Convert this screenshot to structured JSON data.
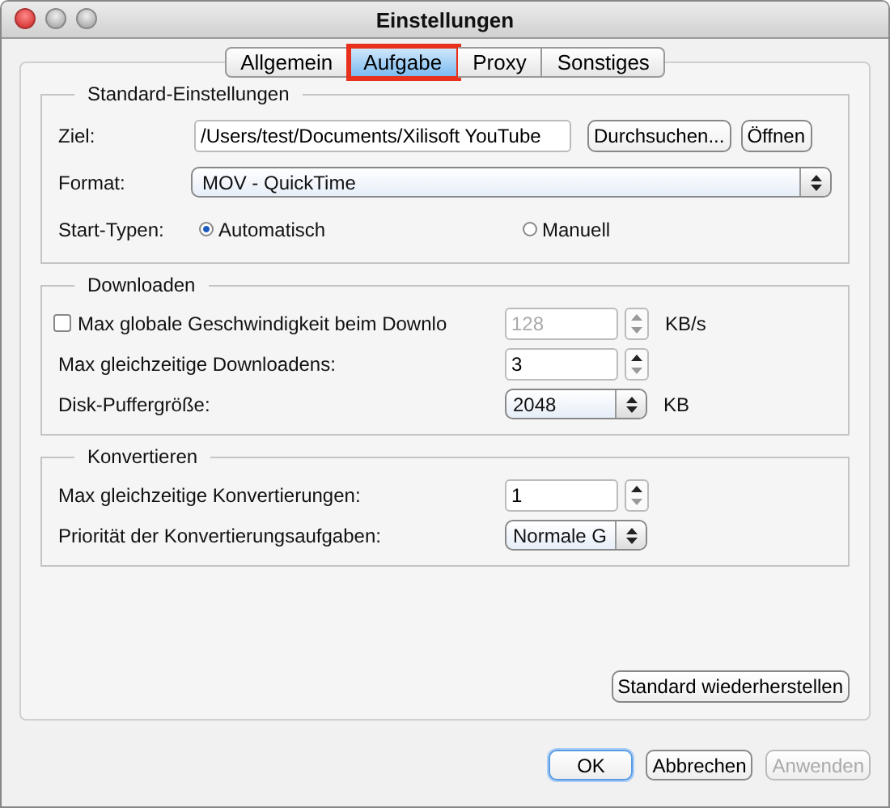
{
  "window": {
    "title": "Einstellungen"
  },
  "tabs": [
    {
      "label": "Allgemein",
      "selected": false,
      "highlighted": false
    },
    {
      "label": "Aufgabe",
      "selected": true,
      "highlighted": true
    },
    {
      "label": "Proxy",
      "selected": false,
      "highlighted": false
    },
    {
      "label": "Sonstiges",
      "selected": false,
      "highlighted": false
    }
  ],
  "standard": {
    "title": "Standard-Einstellungen",
    "destination": {
      "label": "Ziel:",
      "value": "/Users/test/Documents/Xilisoft YouTube"
    },
    "browse_button": "Durchsuchen...",
    "open_button": "Öffnen",
    "format": {
      "label": "Format:",
      "value": "MOV - QuickTime"
    },
    "start_types": {
      "label": "Start-Typen:",
      "options": [
        {
          "label": "Automatisch",
          "selected": true
        },
        {
          "label": "Manuell",
          "selected": false
        }
      ]
    }
  },
  "downloads": {
    "title": "Downloaden",
    "rows": [
      {
        "kind": "check-spinner",
        "label": "Max globale Geschwindigkeit beim Downlo",
        "checked": false,
        "value": "128",
        "disabled": true,
        "unit": "KB/s"
      },
      {
        "kind": "spinner",
        "label": "Max gleichzeitige Downloadens:",
        "value": "3",
        "disabled": false
      },
      {
        "kind": "select",
        "label": "Disk-Puffergröße:",
        "value": "2048",
        "unit": "KB"
      }
    ]
  },
  "convert": {
    "title": "Konvertieren",
    "rows": [
      {
        "kind": "spinner",
        "label": "Max gleichzeitige Konvertierungen:",
        "value": "1",
        "disabled": false
      },
      {
        "kind": "select",
        "label": "Priorität der Konvertierungsaufgaben:",
        "value": "Normale G"
      }
    ]
  },
  "restore_button": "Standard wiederherstellen",
  "buttons": [
    {
      "label": "OK",
      "default": true,
      "disabled": false
    },
    {
      "label": "Abbrechen",
      "default": false,
      "disabled": false
    },
    {
      "label": "Anwenden",
      "default": false,
      "disabled": true
    }
  ]
}
